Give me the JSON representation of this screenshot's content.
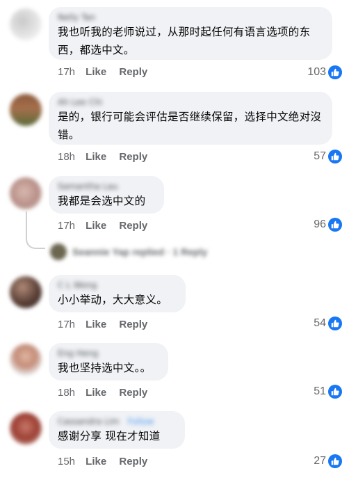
{
  "actions": {
    "like": "Like",
    "reply": "Reply"
  },
  "colors": {
    "bubble": "#f0f2f5",
    "meta": "#65676b",
    "like_blue": "#1877f2"
  },
  "comments": [
    {
      "author": "Nelly Tan",
      "text": "我也听我的老师说过，从那时起任何有语言选项的东西，都选中文。",
      "time": "17h",
      "likes": "103"
    },
    {
      "author": "Ah Lee Chi",
      "text": "是的，银行可能会评估是否继续保留，选择中文绝对沒错。",
      "time": "18h",
      "likes": "57"
    },
    {
      "author": "Samantha Lau",
      "text": "我都是会选中文的",
      "time": "17h",
      "likes": "96"
    },
    {
      "author": "C L Wong",
      "text": "小小举动，大大意义。",
      "time": "17h",
      "likes": "54"
    },
    {
      "author": "Eng Heng",
      "text": "我也坚持选中文。。",
      "time": "18h",
      "likes": "51"
    },
    {
      "author": "Cassandra Lim",
      "text": "感谢分享 现在才知道",
      "time": "15h",
      "likes": "27",
      "follow": "Follow"
    }
  ],
  "reply_summary": "Seannie Yap replied · 1 Reply",
  "icons": {
    "like": "thumbs-up-icon"
  }
}
